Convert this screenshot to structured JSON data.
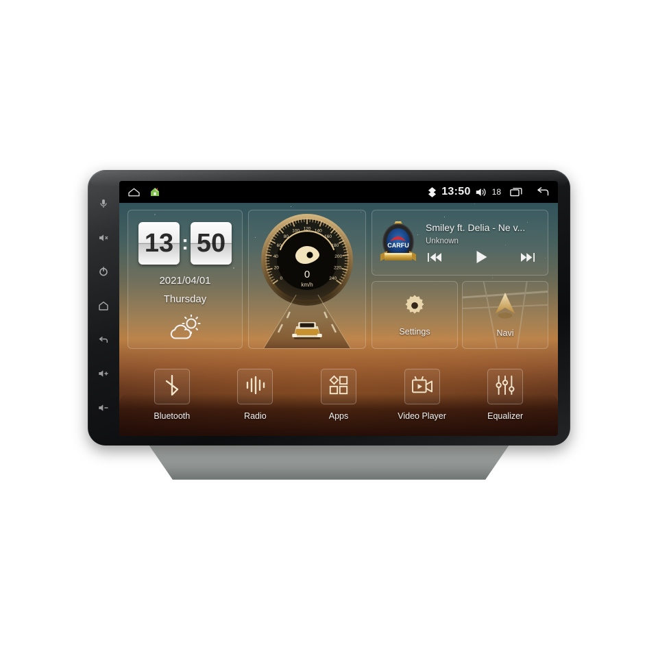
{
  "device": {
    "name": "Android car head unit",
    "bezel_buttons": [
      {
        "name": "mic-button",
        "icon": "microphone-icon"
      },
      {
        "name": "mute-button",
        "icon": "mute-icon"
      },
      {
        "name": "power-button",
        "icon": "power-icon"
      },
      {
        "name": "home-button",
        "icon": "home-icon"
      },
      {
        "name": "back-button",
        "icon": "back-arrow-icon"
      },
      {
        "name": "volume-up-button",
        "icon": "volume-up-icon"
      },
      {
        "name": "volume-down-button",
        "icon": "volume-down-icon"
      }
    ]
  },
  "statusbar": {
    "home_icon": "home-outline-icon",
    "launcher_icon": "green-house-icon",
    "bluetooth_icon": "bluetooth-diamond-icon",
    "time": "13:50",
    "volume_icon": "volume-icon",
    "volume_value": "18",
    "recents_icon": "recents-icon",
    "back_icon": "back-arrow-icon"
  },
  "clock_widget": {
    "hours": "13",
    "separator": ":",
    "minutes": "50",
    "date": "2021/04/01",
    "weekday": "Thursday",
    "weather_icon": "sun-behind-cloud-icon"
  },
  "speed_widget": {
    "value": "0",
    "unit": "km/h",
    "ticks": [
      "0",
      "20",
      "40",
      "60",
      "80",
      "100",
      "120",
      "140",
      "160",
      "180",
      "200",
      "220",
      "240"
    ],
    "min": 0,
    "max": 240,
    "needle_icon": "pointer-icon",
    "road_icon": "car-on-road-icon"
  },
  "music_widget": {
    "badge_text": "CARFU",
    "badge_icon": "carfu-logo-badge",
    "title": "Smiley ft. Delia - Ne v...",
    "artist": "Unknown",
    "controls": [
      {
        "name": "previous-track-button",
        "icon": "previous-icon"
      },
      {
        "name": "play-button",
        "icon": "play-icon"
      },
      {
        "name": "next-track-button",
        "icon": "next-icon"
      }
    ]
  },
  "tiles": [
    {
      "name": "settings-tile",
      "label": "Settings",
      "icon": "gear-icon"
    },
    {
      "name": "navi-tile",
      "label": "Navi",
      "icon": "navigation-arrow-icon"
    }
  ],
  "dock": [
    {
      "name": "dock-item-bluetooth",
      "label": "Bluetooth",
      "icon": "bluetooth-icon"
    },
    {
      "name": "dock-item-radio",
      "label": "Radio",
      "icon": "radio-waves-icon"
    },
    {
      "name": "dock-item-apps",
      "label": "Apps",
      "icon": "apps-grid-icon"
    },
    {
      "name": "dock-item-video",
      "label": "Video Player",
      "icon": "video-camera-icon"
    },
    {
      "name": "dock-item-equalizer",
      "label": "Equalizer",
      "icon": "equalizer-sliders-icon"
    }
  ],
  "colors": {
    "accent_gold": "#e7c489",
    "badge_blue": "#133a72",
    "badge_gold": "#e8c25a",
    "screen_text": "#f3f3f3",
    "statusbar_bg": "#000000"
  }
}
